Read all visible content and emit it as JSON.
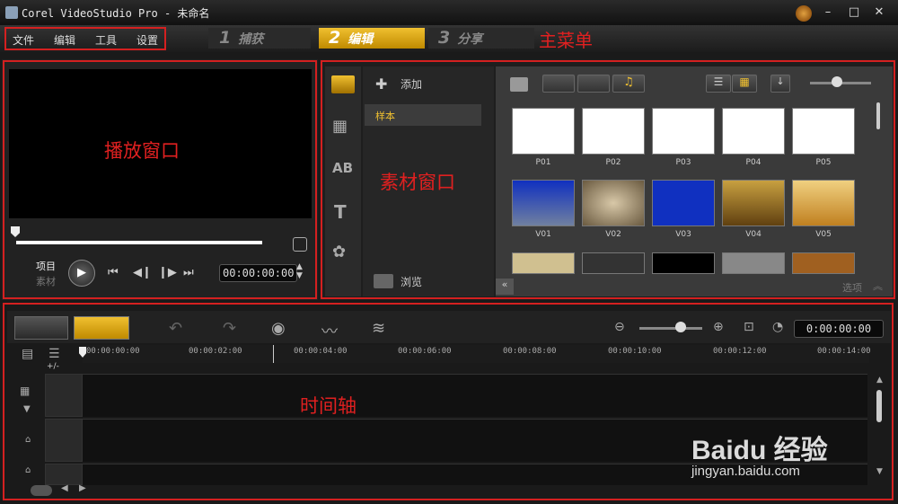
{
  "window": {
    "title": "Corel VideoStudio Pro - 未命名"
  },
  "menu": {
    "file": "文件",
    "edit": "编辑",
    "tools": "工具",
    "settings": "设置"
  },
  "steps": [
    {
      "num": "1",
      "label": "捕获"
    },
    {
      "num": "2",
      "label": "编辑"
    },
    {
      "num": "3",
      "label": "分享"
    }
  ],
  "annotations": {
    "main_menu": "主菜单",
    "player": "播放窗口",
    "library": "素材窗口",
    "timeline": "时间轴"
  },
  "player": {
    "mode_project": "项目",
    "mode_clip": "素材",
    "timecode": "00:00:00:00"
  },
  "library": {
    "add_label": "添加",
    "folder_sample": "样本",
    "browse_label": "浏览",
    "options_label": "选项",
    "thumbs_row1": [
      "P01",
      "P02",
      "P03",
      "P04",
      "P05"
    ],
    "thumbs_row2": [
      "V01",
      "V02",
      "V03",
      "V04",
      "V05"
    ]
  },
  "timeline": {
    "timecode": "0:00:00:00",
    "ticks": [
      "00:00:00:00",
      "00:00:02:00",
      "00:00:04:00",
      "00:00:06:00",
      "00:00:08:00",
      "00:00:10:00",
      "00:00:12:00",
      "00:00:14:00"
    ],
    "track_add": "+/-"
  },
  "watermark": {
    "brand": "Baidu 经验",
    "url": "jingyan.baidu.com"
  },
  "colors": {
    "accent": "#f0c030",
    "annotation_red": "#e02020"
  }
}
